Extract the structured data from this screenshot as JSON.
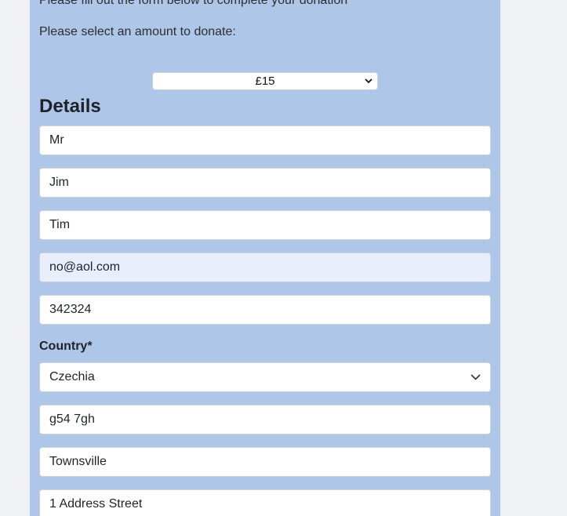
{
  "form": {
    "intro_text": "Please fill out the form below to complete your donation",
    "amount_prompt": "Please select an amount to donate:",
    "amount_selected": "£15",
    "details_heading": "Details",
    "title_value": "Mr",
    "first_name_value": "Jim",
    "last_name_value": "Tim",
    "email_value": "no@aol.com",
    "phone_value": "342324",
    "country_label": "Country*",
    "country_value": "Czechia",
    "postcode_value": "g54 7gh",
    "town_value": "Townsville",
    "address_value": "1 Address Street"
  },
  "colors": {
    "page_background": "#eff1f4",
    "panel_background": "#aec6e8",
    "autofill_background": "#e8eefb"
  },
  "icons": {
    "amount_dropdown": "chevron-down-icon",
    "country_dropdown": "chevron-down-icon"
  }
}
